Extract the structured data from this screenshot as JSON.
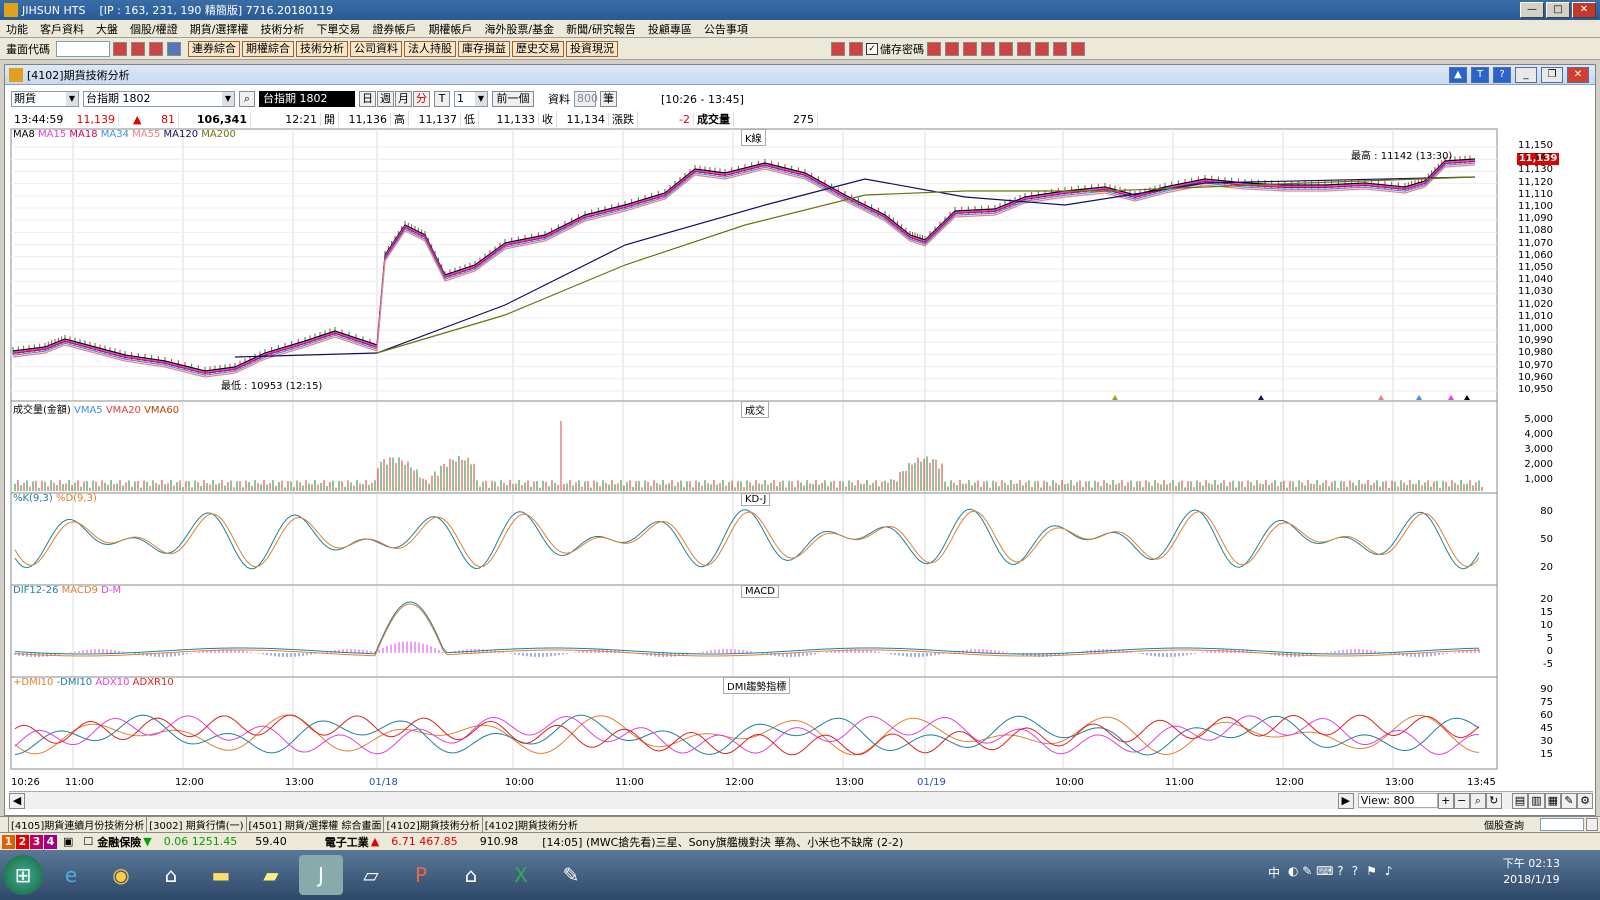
{
  "window": {
    "title": "JIHSUN HTS",
    "ip_info": "[IP : 163, 231, 190 精簡版] 7716.20180119"
  },
  "menu": [
    "功能",
    "客戶資料",
    "大盤",
    "個股/權證",
    "期貨/選擇權",
    "技術分析",
    "下單交易",
    "證券帳戶",
    "期權帳戶",
    "海外股票/基金",
    "新聞/研究報告",
    "投顧專區",
    "公告事項"
  ],
  "toolbar": {
    "code_label": "畫面代碼",
    "buttons": [
      "連券綜合",
      "期權綜合",
      "技術分析",
      "公司資料",
      "法人持股",
      "庫存損益",
      "歷史交易",
      "投資現況"
    ],
    "save_password_label": "儲存密碼"
  },
  "doc": {
    "title": "[4102]期貨技術分析",
    "product_type": "期貨",
    "contract": "台指期 1802",
    "contract_display": "台指期 1802",
    "periods": [
      "日",
      "週",
      "月",
      "分"
    ],
    "period_active": "分",
    "interval": "1",
    "prev_label": "前一個",
    "data_label": "資料",
    "data_count": "800",
    "data_unit": "筆",
    "time_range": "[10:26 - 13:45]"
  },
  "quote": {
    "time": "13:44:59",
    "price": "11,139",
    "change": "81",
    "volume_total": "106,341",
    "time2": "12:21",
    "open_label": "開",
    "open": "11,136",
    "high_label": "高",
    "high": "11,137",
    "low_label": "低",
    "low": "11,133",
    "close_label": "收",
    "close": "11,134",
    "chg_label": "漲跌",
    "chg": "-2",
    "vol_label": "成交量",
    "vol": "275"
  },
  "panels": {
    "k": {
      "title": "K線",
      "legend": [
        "MA8",
        "MA15",
        "MA18",
        "MA34",
        "MA55",
        "MA120",
        "MA200"
      ],
      "legend_colors": [
        "#000000",
        "#e040e0",
        "#d00060",
        "#4090e0",
        "#f08080",
        "#101060",
        "#707010"
      ],
      "high_note": "最高 : 11142 (13:30)",
      "low_note": "最低 : 10953 (12:15)",
      "last_price": "11,139"
    },
    "vol": {
      "title": "成交",
      "legend": [
        "成交量(金額)",
        "VMA5",
        "VMA20",
        "VMA60"
      ],
      "legend_colors": [
        "#000000",
        "#4090e0",
        "#e04040",
        "#c04000"
      ]
    },
    "kd": {
      "title": "KD-J",
      "legend": [
        "%K(9,3)",
        "%D(9,3)"
      ],
      "legend_colors": [
        "#2080a0",
        "#e08030"
      ]
    },
    "macd": {
      "title": "MACD",
      "legend": [
        "DIF12-26",
        "MACD9",
        "D-M"
      ],
      "legend_colors": [
        "#2080a0",
        "#e08030",
        "#e040e0"
      ]
    },
    "dmi": {
      "title": "DMI趨勢指標",
      "legend": [
        "+DMI10",
        "-DMI10",
        "ADX10",
        "ADXR10"
      ],
      "legend_colors": [
        "#e08030",
        "#2080a0",
        "#e040e0",
        "#e02020"
      ]
    }
  },
  "axes": {
    "price_ticks": [
      "11,150",
      "11,140",
      "11,130",
      "11,120",
      "11,110",
      "11,100",
      "11,090",
      "11,080",
      "11,070",
      "11,060",
      "11,050",
      "11,040",
      "11,030",
      "11,020",
      "11,010",
      "11,000",
      "10,990",
      "10,980",
      "10,970",
      "10,960",
      "10,950"
    ],
    "vol_ticks": [
      "5,000",
      "4,000",
      "3,000",
      "2,000",
      "1,000"
    ],
    "kd_ticks": [
      "80",
      "50",
      "20"
    ],
    "macd_ticks": [
      "20",
      "15",
      "10",
      "5",
      "0",
      "-5"
    ],
    "dmi_ticks": [
      "90",
      "75",
      "60",
      "45",
      "30",
      "15"
    ],
    "x_ticks": [
      "10:26",
      "11:00",
      "12:00",
      "13:00",
      "01/18",
      "10:00",
      "11:00",
      "12:00",
      "13:00",
      "01/19",
      "10:00",
      "11:00",
      "12:00",
      "13:00",
      "13:45"
    ]
  },
  "view_label": "View: 800",
  "tabs": [
    "[4105]期貨連續月份技術分析",
    "[3002] 期貨行情(一)",
    "[4501] 期貨/選擇權 綜合畫面",
    "[4102]期貨技術分析",
    "[4102]期貨技術分析"
  ],
  "stock_query_label": "個股查詢",
  "ticker": {
    "numbers": [
      "1",
      "2",
      "3",
      "4"
    ],
    "item1_name": "金融保險",
    "item1_vals": "0.06 1251.45",
    "item1_v2": "59.40",
    "item2_name": "電子工業",
    "item2_vals": "6.71 467.85",
    "item2_v2": "910.98",
    "news": "[14:05] (MWC搶先看)三星、Sony旗艦機對決 華為、小米也不缺席 (2-2)"
  },
  "taskbar": {
    "clock_time": "下午 02:13",
    "clock_date": "2018/1/19",
    "ime": "中"
  }
}
